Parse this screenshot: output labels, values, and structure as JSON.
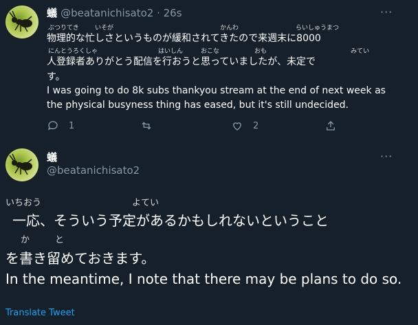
{
  "tweet1": {
    "display_name": "蟻",
    "handle_time": "@beatanichisato2 · 26s",
    "line1_furigana": [
      "ぶつりてき",
      "いそが",
      "かんわ",
      "らいしゅうまつ"
    ],
    "line1_text": "物理的な忙しさというものが緩和されてきたので来週末に8000",
    "line2_furigana": [
      "にんとうろくしゃ",
      "はいしん",
      "おこな",
      "おも",
      "みてい"
    ],
    "line2_text": "人登録者ありがとう配信を行おうと思っていましたが、未定で",
    "line3_text": "す。",
    "english": "I was going to do 8k subs thankyou stream at the end of next week as the physical busyness thing has eased, but it's still undecided.",
    "reply_count": "1",
    "like_count": "2"
  },
  "tweet2": {
    "display_name": "蟻",
    "handle": "@beatanichisato2",
    "line1_furigana": [
      "いちおう",
      "よてい"
    ],
    "line1_text": "一応、そういう予定があるかもしれないということ",
    "line2_furigana": [
      "か",
      "と"
    ],
    "line2_text": "を書き留めておきます。",
    "english": "In the meantime, I note that there may be plans to do so.",
    "translate_label": "Translate Tweet"
  },
  "icons": [
    "reply-icon",
    "retweet-icon",
    "like-icon",
    "share-icon",
    "more-icon"
  ],
  "colors": {
    "background": "#15202b",
    "secondary_text": "#8899a6",
    "link": "#1da1f2"
  }
}
